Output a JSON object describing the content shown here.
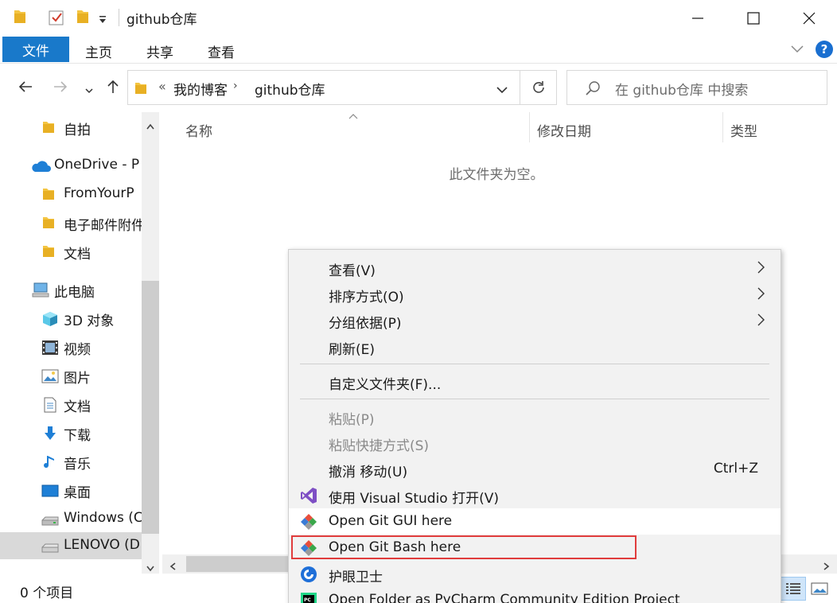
{
  "window": {
    "title": "github仓库",
    "controls": [
      "minimize-icon",
      "maximize-icon",
      "close-icon"
    ]
  },
  "ribbon": {
    "file_tab": "文件",
    "tabs": [
      "主页",
      "共享",
      "查看"
    ],
    "help": "?",
    "accent": "#1979ca"
  },
  "address": {
    "overflow": "«",
    "crumbs": [
      "我的博客",
      "github仓库"
    ],
    "separator": "›"
  },
  "search": {
    "placeholder": "在 github仓库 中搜索"
  },
  "nav": {
    "items": [
      {
        "label": "自拍",
        "icon": "folder-icon"
      },
      {
        "label": "OneDrive - P",
        "icon": "onedrive-cloud-icon"
      },
      {
        "label": "FromYourP",
        "icon": "folder-icon"
      },
      {
        "label": "电子邮件附件",
        "icon": "folder-icon"
      },
      {
        "label": "文档",
        "icon": "folder-icon"
      },
      {
        "label": "此电脑",
        "icon": "this-pc-icon"
      },
      {
        "label": "3D 对象",
        "icon": "3d-objects-icon"
      },
      {
        "label": "视频",
        "icon": "videos-icon"
      },
      {
        "label": "图片",
        "icon": "pictures-icon"
      },
      {
        "label": "文档",
        "icon": "documents-icon"
      },
      {
        "label": "下载",
        "icon": "downloads-icon"
      },
      {
        "label": "音乐",
        "icon": "music-icon"
      },
      {
        "label": "桌面",
        "icon": "desktop-icon"
      },
      {
        "label": "Windows (C",
        "icon": "drive-icon"
      },
      {
        "label": "LENOVO (D",
        "icon": "drive-icon"
      }
    ]
  },
  "content": {
    "columns": [
      "名称",
      "修改日期",
      "类型"
    ],
    "empty_message": "此文件夹为空。"
  },
  "status": {
    "item_count": "0 个项目"
  },
  "context_menu": {
    "items": [
      {
        "label": "查看(V)",
        "submenu": true
      },
      {
        "label": "排序方式(O)",
        "submenu": true
      },
      {
        "label": "分组依据(P)",
        "submenu": true
      },
      {
        "label": "刷新(E)"
      },
      {
        "label": "自定义文件夹(F)..."
      },
      {
        "label": "粘贴(P)",
        "disabled": true
      },
      {
        "label": "粘贴快捷方式(S)",
        "disabled": true
      },
      {
        "label": "撤消 移动(U)",
        "shortcut": "Ctrl+Z"
      },
      {
        "label": "使用 Visual Studio 打开(V)",
        "icon": "visual-studio-icon"
      },
      {
        "label": "Open Git GUI here",
        "icon": "git-gui-icon"
      },
      {
        "label": "Open Git Bash here",
        "icon": "git-bash-icon",
        "highlighted": true
      },
      {
        "label": "护眼卫士",
        "icon": "eye-guard-icon"
      },
      {
        "label": "Open Folder as PyCharm Community Edition Project",
        "icon": "pycharm-icon"
      }
    ],
    "highlight_color": "#e03c3c"
  }
}
